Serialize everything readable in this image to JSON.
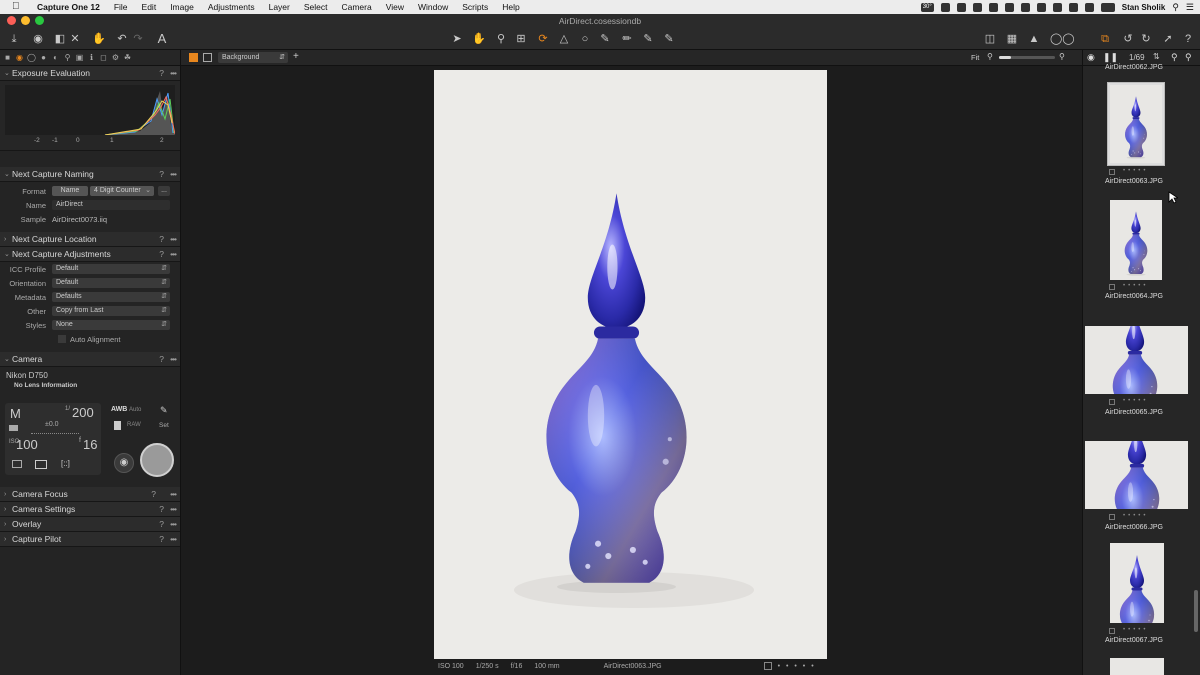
{
  "menubar": {
    "app_name": "Capture One 12",
    "items": [
      "File",
      "Edit",
      "Image",
      "Adjustments",
      "Layer",
      "Select",
      "Camera",
      "View",
      "Window",
      "Scripts",
      "Help"
    ],
    "temperature": "30°",
    "user": "Stan Sholik"
  },
  "window": {
    "title": "AirDirect.cosessiondb"
  },
  "viewer": {
    "background_select": "Background",
    "zoom_label": "Fit",
    "info": {
      "iso": "ISO 100",
      "shutter": "1/250 s",
      "aperture": "f/16",
      "focal": "100 mm",
      "filename": "AirDirect0063.JPG",
      "rating_dots": "• • • • •"
    }
  },
  "exposure": {
    "title": "Exposure Evaluation",
    "scale": [
      "-2",
      "-1",
      "0",
      "1",
      "2"
    ]
  },
  "naming": {
    "title": "Next Capture Naming",
    "format_label": "Format",
    "format_tokens": [
      "Name",
      "4 Digit Counter"
    ],
    "format_more": "...",
    "name_label": "Name",
    "name_value": "AirDirect",
    "sample_label": "Sample",
    "sample_value": "AirDirect0073.iiq"
  },
  "location": {
    "title": "Next Capture Location"
  },
  "adjustments": {
    "title": "Next Capture Adjustments",
    "rows": [
      {
        "label": "ICC Profile",
        "value": "Default"
      },
      {
        "label": "Orientation",
        "value": "Default"
      },
      {
        "label": "Metadata",
        "value": "Defaults"
      },
      {
        "label": "Other",
        "value": "Copy from Last"
      },
      {
        "label": "Styles",
        "value": "None"
      }
    ],
    "auto_alignment": "Auto Alignment"
  },
  "camera": {
    "title": "Camera",
    "model": "Nikon D750",
    "lens": "No Lens Information",
    "mode": "M",
    "shutter_prefix": "1/",
    "shutter": "200",
    "ev": "±0.0",
    "iso": "100",
    "aperture_prefix": "f",
    "aperture": "16",
    "wb": "AWB",
    "wb_mode": "Auto",
    "format": "RAW",
    "set": "Set"
  },
  "collapsed_sections": [
    "Camera Focus",
    "Camera Settings",
    "Overlay",
    "Capture Pilot"
  ],
  "browser": {
    "count": "1/69",
    "thumbs": [
      {
        "name": "AirDirect0062.JPG"
      },
      {
        "name": "AirDirect0063.JPG"
      },
      {
        "name": "AirDirect0064.JPG"
      },
      {
        "name": "AirDirect0065.JPG"
      },
      {
        "name": "AirDirect0066.JPG"
      },
      {
        "name": "AirDirect0067.JPG"
      }
    ]
  },
  "colors": {
    "accent": "#e8871e",
    "panel": "#242424",
    "bottle": "#3a3fb8"
  }
}
